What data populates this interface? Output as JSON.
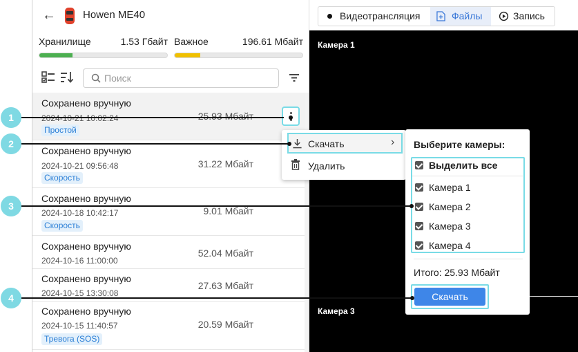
{
  "header": {
    "title": "Howen ME40"
  },
  "storage": [
    {
      "label": "Хранилище",
      "value": "1.53 Гбайт",
      "fill_pct": 0.26,
      "color": "#4caf50"
    },
    {
      "label": "Важное",
      "value": "196.61 Мбайт",
      "fill_pct": 0.2,
      "color": "#f0c000"
    }
  ],
  "search": {
    "placeholder": "Поиск"
  },
  "records": [
    {
      "title": "Сохранено вручную",
      "date": "2024-10-21 10:02:24",
      "size": "25.93 Мбайт",
      "tag": "Простой"
    },
    {
      "title": "Сохранено вручную",
      "date": "2024-10-21 09:56:48",
      "size": "31.22 Мбайт",
      "tag": "Скорость"
    },
    {
      "title": "Сохранено вручную",
      "date": "2024-10-18 10:42:17",
      "size": "9.01 Мбайт",
      "tag": "Скорость"
    },
    {
      "title": "Сохранено вручную",
      "date": "2024-10-16 11:00:00",
      "size": "52.04 Мбайт",
      "tag": ""
    },
    {
      "title": "Сохранено вручную",
      "date": "2024-10-15 13:30:08",
      "size": "27.63 Мбайт",
      "tag": ""
    },
    {
      "title": "Сохранено вручную",
      "date": "2024-10-15 11:40:57",
      "size": "20.59 Мбайт",
      "tag": "Тревога (SOS)"
    }
  ],
  "tabs": {
    "live": "Видеотрансляция",
    "files": "Файлы",
    "record": "Запись"
  },
  "video": {
    "cam1": "Камера 1",
    "cam3": "Камера 3"
  },
  "context_menu": {
    "download": "Скачать",
    "delete": "Удалить"
  },
  "camera_panel": {
    "title": "Выберите камеры:",
    "select_all": "Выделить все",
    "cameras": [
      "Камера 1",
      "Камера 2",
      "Камера 3",
      "Камера 4"
    ],
    "total": "Итого: 25.93 Мбайт",
    "download_button": "Скачать"
  },
  "callouts": [
    "1",
    "2",
    "3",
    "4"
  ],
  "colors": {
    "accent": "#3e86e8",
    "highlight": "#79dbe6",
    "callout": "#7fd9e3",
    "tag_text": "#2b7fd6"
  }
}
